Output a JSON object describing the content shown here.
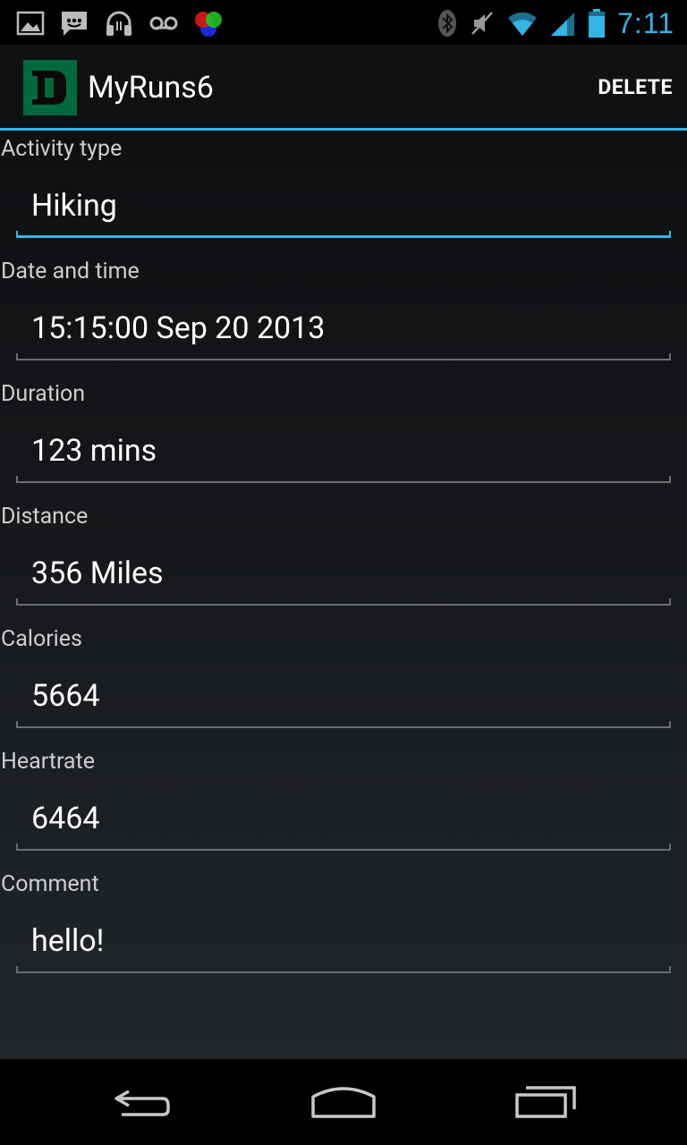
{
  "status_bar": {
    "time": "7:11",
    "left_icons": [
      "gallery-icon",
      "message-icon",
      "headphones-icon",
      "voicemail-icon",
      "colors-icon"
    ],
    "right_icons": [
      "bluetooth-icon",
      "mute-icon",
      "wifi-icon",
      "signal-icon",
      "battery-icon"
    ]
  },
  "action_bar": {
    "title": "MyRuns6",
    "logo_letter": "D",
    "delete_label": "DELETE"
  },
  "fields": [
    {
      "label": "Activity type",
      "value": "Hiking",
      "focused": true
    },
    {
      "label": "Date and time",
      "value": "15:15:00 Sep 20 2013"
    },
    {
      "label": "Duration",
      "value": "123 mins"
    },
    {
      "label": "Distance",
      "value": "356 Miles"
    },
    {
      "label": "Calories",
      "value": "5664"
    },
    {
      "label": "Heartrate",
      "value": "6464"
    },
    {
      "label": "Comment",
      "value": "hello!"
    }
  ],
  "nav_bar": {
    "buttons": [
      "back-icon",
      "home-icon",
      "recent-apps-icon"
    ]
  },
  "colors": {
    "accent": "#33b5e5",
    "logo_green": "#00693e"
  }
}
